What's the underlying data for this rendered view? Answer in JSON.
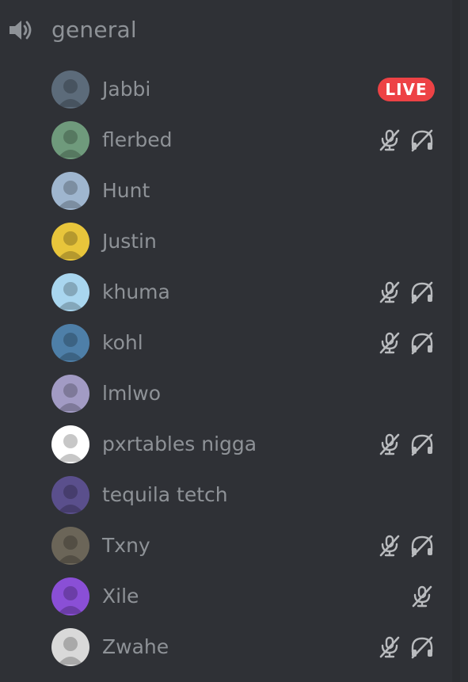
{
  "channel": {
    "name": "general",
    "icon": "speaker-icon"
  },
  "members": [
    {
      "name": "Jabbi",
      "live": true,
      "live_label": "LIVE",
      "muted": false,
      "deafened": false,
      "avatar_bg": "#5c6b7a"
    },
    {
      "name": "flerbed",
      "live": false,
      "muted": true,
      "deafened": true,
      "avatar_bg": "#6f9a7c"
    },
    {
      "name": "Hunt",
      "live": false,
      "muted": false,
      "deafened": false,
      "avatar_bg": "#9fb6cf"
    },
    {
      "name": "Justin",
      "live": false,
      "muted": false,
      "deafened": false,
      "avatar_bg": "#e8c53b"
    },
    {
      "name": "khuma",
      "live": false,
      "muted": true,
      "deafened": true,
      "avatar_bg": "#a9d6ef"
    },
    {
      "name": "kohl",
      "live": false,
      "muted": true,
      "deafened": true,
      "avatar_bg": "#4e7fa8"
    },
    {
      "name": "lmlwo",
      "live": false,
      "muted": false,
      "deafened": false,
      "avatar_bg": "#a29bc4"
    },
    {
      "name": "pxrtables nigga",
      "live": false,
      "muted": true,
      "deafened": true,
      "avatar_bg": "#ffffff"
    },
    {
      "name": "tequila tetch",
      "live": false,
      "muted": false,
      "deafened": false,
      "avatar_bg": "#5a4f8c"
    },
    {
      "name": "Txny",
      "live": false,
      "muted": true,
      "deafened": true,
      "avatar_bg": "#6b6558"
    },
    {
      "name": "Xile",
      "live": false,
      "muted": true,
      "deafened": false,
      "avatar_bg": "#8a4fd6"
    },
    {
      "name": "Zwahe",
      "live": false,
      "muted": true,
      "deafened": true,
      "avatar_bg": "#d9d9d9"
    }
  ],
  "colors": {
    "background": "#2f3136",
    "text_muted": "#8e9297",
    "icon": "#b9bbbe",
    "live_badge": "#ed4245"
  }
}
